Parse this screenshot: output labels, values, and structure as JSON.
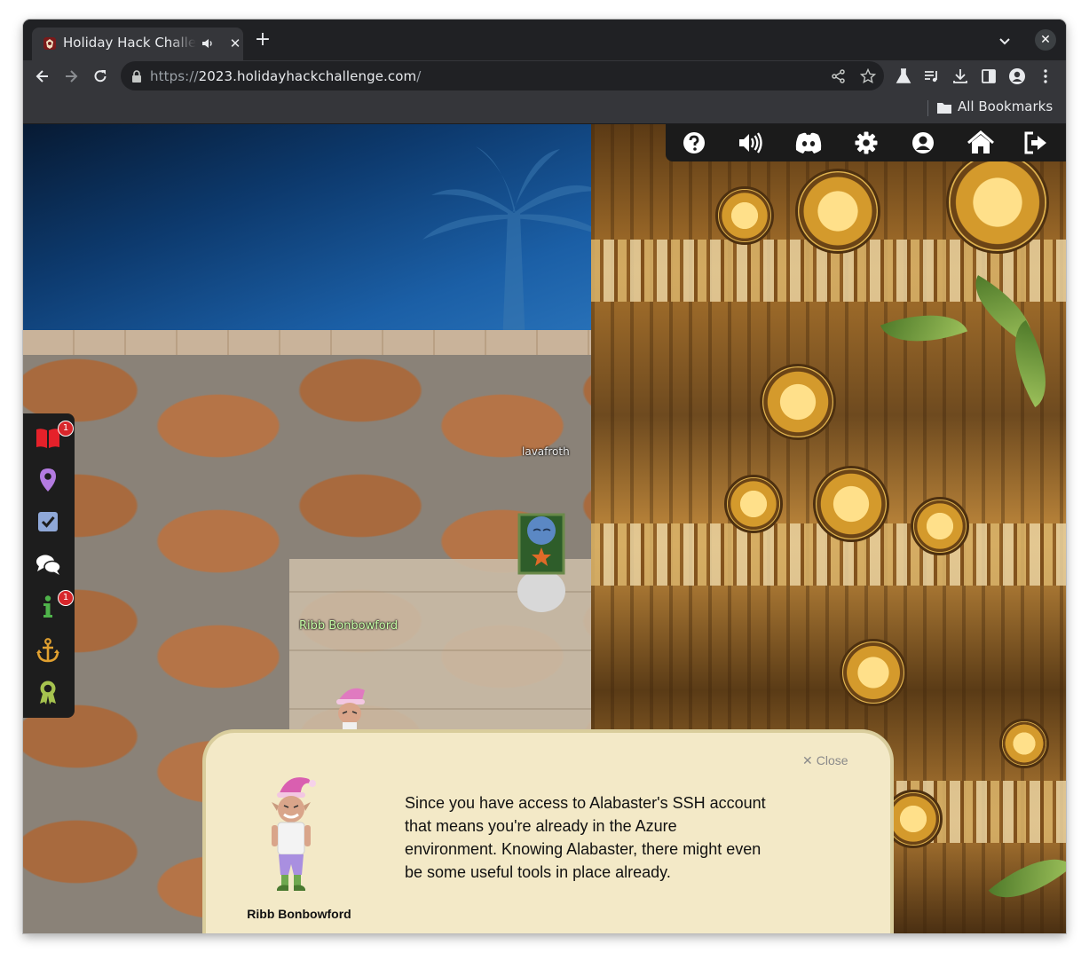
{
  "browser": {
    "tab": {
      "title": "Holiday Hack Challenge",
      "favicon": "holiday-hack-favicon",
      "audio_icon": "speaker-icon"
    },
    "url": {
      "scheme": "https://",
      "host": "2023.holidayhackchallenge.com",
      "path": "/"
    },
    "bookmarks": {
      "folder_label": "All Bookmarks"
    }
  },
  "game": {
    "top_icons": [
      "help-icon",
      "volume-icon",
      "discord-icon",
      "settings-icon",
      "profile-icon",
      "home-icon",
      "logout-icon"
    ],
    "side_icons": [
      {
        "name": "badge-book-icon",
        "badge": "1"
      },
      {
        "name": "location-pin-icon",
        "badge": ""
      },
      {
        "name": "objectives-check-icon",
        "badge": ""
      },
      {
        "name": "chat-icon",
        "badge": ""
      },
      {
        "name": "info-icon",
        "badge": "1"
      },
      {
        "name": "anchor-icon",
        "badge": ""
      },
      {
        "name": "achievements-icon",
        "badge": ""
      }
    ],
    "player_names": {
      "player": "lavafroth",
      "npc": "Ribb Bonbowford"
    },
    "colors": {
      "sidebar_bg": "#1d1d1d",
      "dialog_bg": "#f3e9c7",
      "badge": "#d7262b"
    }
  },
  "dialog": {
    "close_label": "Close",
    "speaker": "Ribb Bonbowford",
    "text": "Since you have access to Alabaster's SSH account that means you're already in the Azure environment. Knowing Alabaster, there might even be some useful tools in place already."
  }
}
